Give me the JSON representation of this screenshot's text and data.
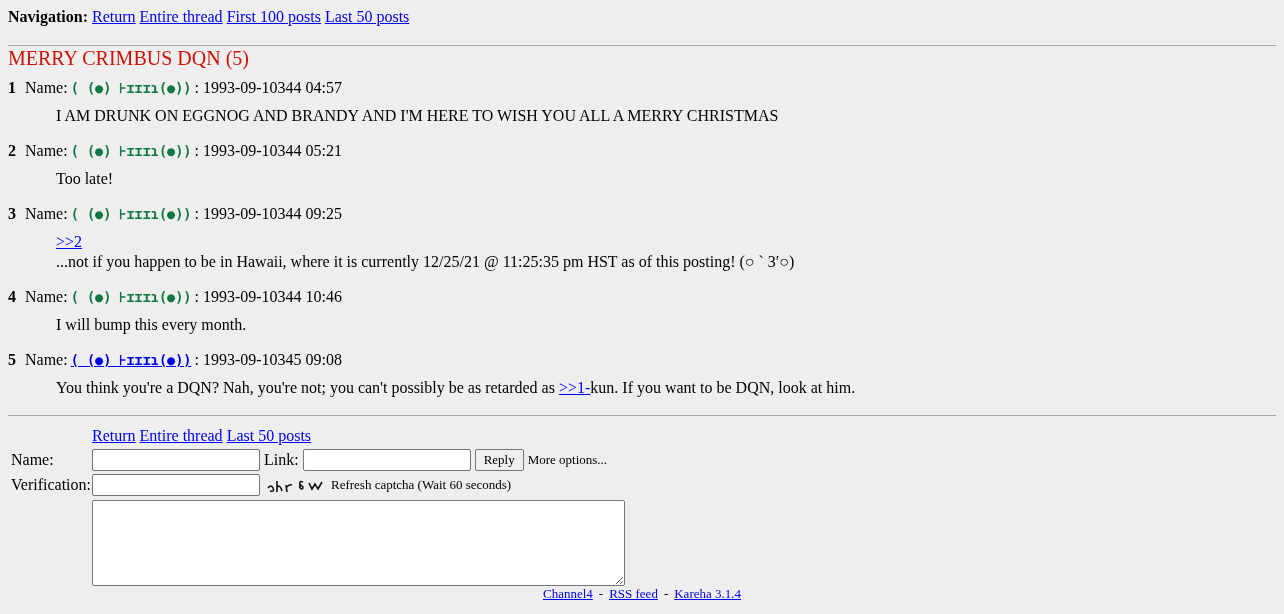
{
  "navigation": {
    "label": "Navigation:",
    "links": [
      "Return",
      "Entire thread",
      "First 100 posts",
      "Last 50 posts"
    ]
  },
  "thread": {
    "title": "MERRY CRIMBUS DQN (5)"
  },
  "posts": [
    {
      "number": "1",
      "name_label": "Name:",
      "name": "( (●) ⊦ɪɪɪɿ(●))",
      "linked": false,
      "date": ": 1993-09-10344 04:57",
      "lines": [
        [
          {
            "kind": "text",
            "text": "I AM DRUNK ON EGGNOG AND BRANDY AND I'M HERE TO WISH YOU ALL A MERRY CHRISTMAS"
          }
        ]
      ]
    },
    {
      "number": "2",
      "name_label": "Name:",
      "name": "( (●) ⊦ɪɪɪɿ(●))",
      "linked": false,
      "date": ": 1993-09-10344 05:21",
      "lines": [
        [
          {
            "kind": "text",
            "text": "Too late!"
          }
        ]
      ]
    },
    {
      "number": "3",
      "name_label": "Name:",
      "name": "( (●) ⊦ɪɪɪɿ(●))",
      "linked": false,
      "date": ": 1993-09-10344 09:25",
      "lines": [
        [
          {
            "kind": "link",
            "text": ">>2"
          }
        ],
        [
          {
            "kind": "text",
            "text": "...not if you happen to be in Hawaii, where it is currently 12/25/21 @ 11:25:35 pm HST as of this posting! (○ ` 3′○)"
          }
        ]
      ]
    },
    {
      "number": "4",
      "name_label": "Name:",
      "name": "( (●) ⊦ɪɪɪɿ(●))",
      "linked": false,
      "date": ": 1993-09-10344 10:46",
      "lines": [
        [
          {
            "kind": "text",
            "text": "I will bump this every month."
          }
        ]
      ]
    },
    {
      "number": "5",
      "name_label": "Name:",
      "name": "( (●) ⊦ɪɪɪɿ(●))",
      "linked": true,
      "date": ": 1993-09-10345 09:08",
      "lines": [
        [
          {
            "kind": "text",
            "text": "You think you're a DQN? Nah, you're not; you can't possibly be as retarded as "
          },
          {
            "kind": "link",
            "text": ">>1-"
          },
          {
            "kind": "text",
            "text": "kun. If you want to be DQN, look at him."
          }
        ]
      ]
    }
  ],
  "reply_form": {
    "links": [
      "Return",
      "Entire thread",
      "Last 50 posts"
    ],
    "name_label": "Name:",
    "link_label": "Link:",
    "submit": "Reply",
    "more_options": "More options...",
    "verification_label": "Verification:",
    "captcha_note": "Refresh captcha (Wait 60 seconds)"
  },
  "footer": {
    "links": [
      "Channel4",
      "RSS feed",
      "Kareha 3.1.4"
    ],
    "separator": "-"
  }
}
